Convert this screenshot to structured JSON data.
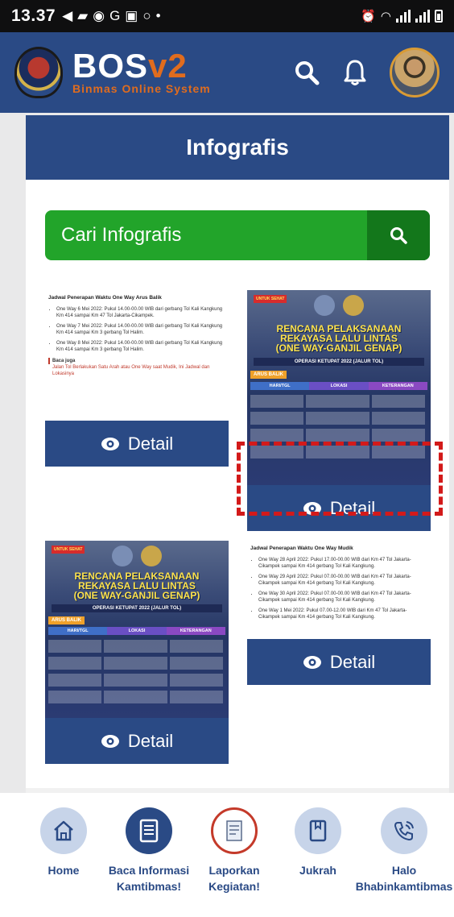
{
  "status_bar": {
    "time": "13.37"
  },
  "app_header": {
    "brand_name_main": "BOS",
    "brand_name_version": "v2",
    "brand_tagline": "Binmas Online System"
  },
  "page": {
    "title": "Infografis"
  },
  "search": {
    "placeholder": "Cari Infografis"
  },
  "infographics": [
    {
      "heading": "Jadwal Penerapan Waktu One Way Arus Balik",
      "items": [
        "One Way 6 Mei 2022: Pukul 14.00-00.00 WIB dari gerbang Tol Kali Kangkung Km 414 sampai Km 47 Tol Jakarta-Cikampek.",
        "One Way 7 Mei 2022: Pukul 14.00-00.00 WIB dari gerbang Tol Kali Kangkung Km 414 sampai Km 3 gerbang Tol Halim.",
        "One Way 8 Mei 2022: Pukul 14.00-00.00 WIB dari gerbang Tol Kali Kangkung Km 414 sampai Km 3 gerbang Tol Halim."
      ],
      "note_title": "Baca juga",
      "note": "Jalan Tol Berlakukan Satu Arah atau One Way saat Mudik, Ini Jadwal dan Lokasinya",
      "detail_label": "Detail"
    },
    {
      "badge": "UNTUK SEHAT",
      "title_lines": [
        "RENCANA PELAKSANAAN",
        "REKAYASA LALU LINTAS",
        "(ONE WAY-GANJIL GENAP)"
      ],
      "subtitle": "OPERASI KETUPAT 2022 (JALUR TOL)",
      "tag": "ARUS BALIK",
      "columns": [
        "HARI/TGL",
        "LOKASI",
        "KETERANGAN"
      ],
      "detail_label": "Detail"
    },
    {
      "badge": "UNTUK SEHAT",
      "title_lines": [
        "RENCANA PELAKSANAAN",
        "REKAYASA LALU LINTAS",
        "(ONE WAY-GANJIL GENAP)"
      ],
      "subtitle": "OPERASI KETUPAT 2022 (JALUR TOL)",
      "tag": "ARUS BALIK",
      "columns": [
        "HARI/TGL",
        "LOKASI",
        "KETERANGAN"
      ],
      "detail_label": "Detail"
    },
    {
      "heading": "Jadwal Penerapan Waktu One Way Mudik",
      "items": [
        "One Way 28 April 2022: Pukul 17.00-00.00 WIB dari Km 47 Tol Jakarta-Cikampek sampai Km 414 gerbang Tol Kali Kangkung.",
        "One Way 29 April 2022: Pukul 07.00-00.00 WIB dari Km 47 Tol Jakarta-Cikampek sampai Km 414 gerbang Tol Kali Kangkung.",
        "One Way 30 April 2022: Pukul 07.00-00.00 WIB dari Km 47 Tol Jakarta-Cikampek sampai Km 414 gerbang Tol Kali Kangkung.",
        "One Way 1 Mei 2022: Pukul 07.00-12.00 WIB dari Km 47 Tol Jakarta-Cikampek sampai Km 414 gerbang Tol Kali Kangkung."
      ],
      "detail_label": "Detail"
    }
  ],
  "bottom_nav": [
    {
      "label": "Home",
      "icon": "home-icon"
    },
    {
      "label": "Baca Informasi Kamtibmas!",
      "icon": "document-icon"
    },
    {
      "label": "Laporkan Kegiatan!",
      "icon": "report-icon"
    },
    {
      "label": "Jukrah",
      "icon": "book-icon"
    },
    {
      "label": "Halo Bhabinkamtibmas",
      "icon": "phone-icon"
    }
  ],
  "colors": {
    "primary": "#2a4a85",
    "search_green": "#22a42a",
    "search_button": "#13771b",
    "highlight": "#d31a1a",
    "brand_accent": "#e06c1e"
  }
}
